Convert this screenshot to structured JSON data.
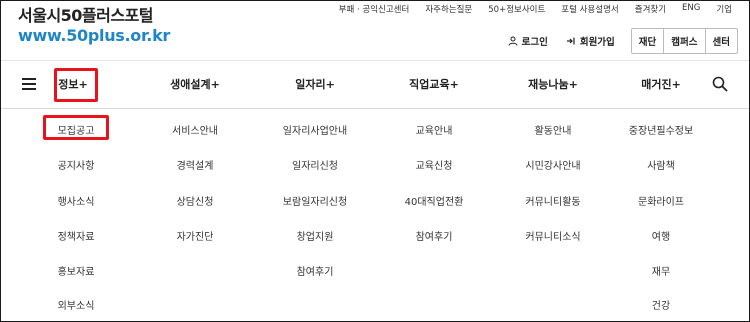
{
  "logo": {
    "title": "서울시50플러스포털",
    "url": "www.50plus.or.kr"
  },
  "util_links": [
    "부패 · 공익신고센터",
    "자주하는질문",
    "50+정보사이트",
    "포털 사용설명서",
    "즐겨찾기",
    "ENG",
    "기업"
  ],
  "user_buttons": {
    "login": "로그인",
    "signup": "회원가입"
  },
  "org_tabs": [
    "재단",
    "캠퍼스",
    "센터"
  ],
  "nav": [
    "정보+",
    "생애설계+",
    "일자리+",
    "직업교육+",
    "재능나눔+",
    "매거진+"
  ],
  "highlight_color": "#e8141b",
  "submenu": [
    [
      "모집공고",
      "공지사항",
      "행사소식",
      "정책자료",
      "홍보자료",
      "외부소식"
    ],
    [
      "서비스안내",
      "경력설계",
      "상담신청",
      "자가진단"
    ],
    [
      "일자리사업안내",
      "일자리신청",
      "보람일자리신청",
      "창업지원",
      "참여후기"
    ],
    [
      "교육안내",
      "교육신청",
      "40대직업전환",
      "참여후기"
    ],
    [
      "활동안내",
      "시민강사안내",
      "커뮤니티활동",
      "커뮤니티소식"
    ],
    [
      "중장년필수정보",
      "사람책",
      "문화라이프",
      "여행",
      "재무",
      "건강"
    ]
  ]
}
